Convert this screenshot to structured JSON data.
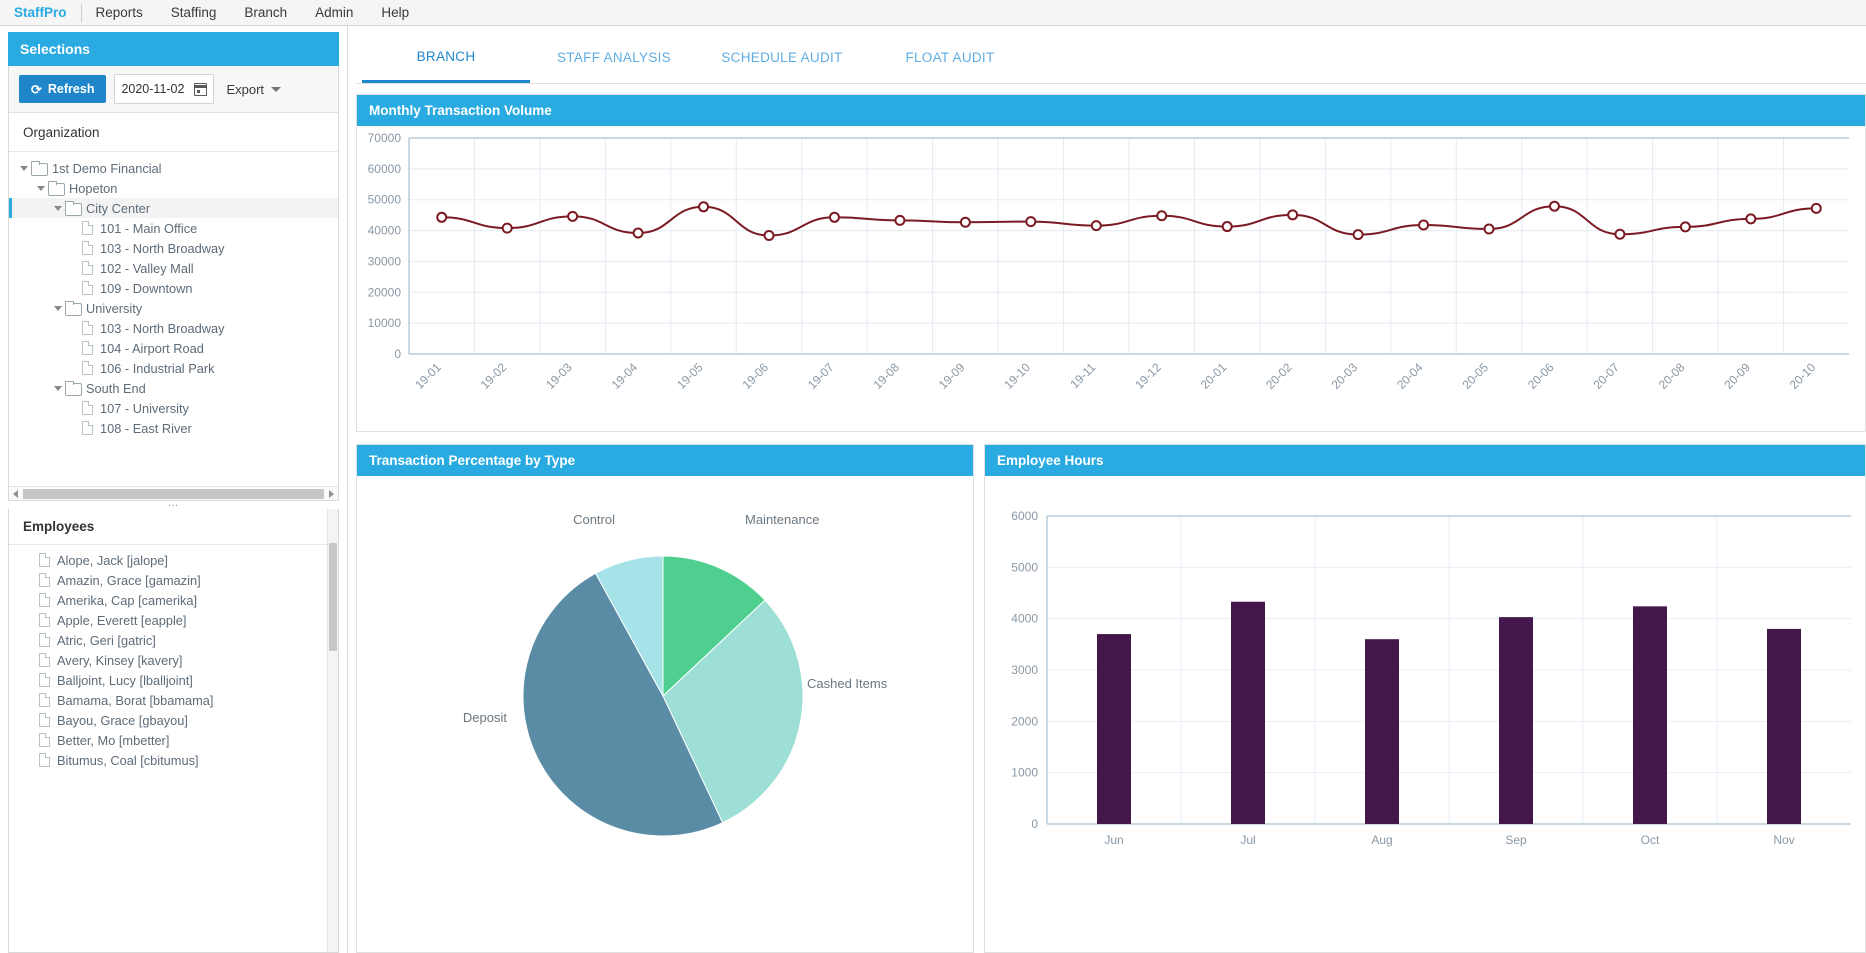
{
  "menu": {
    "brand": "StaffPro",
    "items": [
      "Reports",
      "Staffing",
      "Branch",
      "Admin",
      "Help"
    ]
  },
  "selections": {
    "title": "Selections",
    "refresh_label": "Refresh",
    "date_value": "2020-11-02",
    "export_label": "Export",
    "organization_label": "Organization",
    "tree": [
      {
        "label": "1st Demo Financial",
        "type": "folder",
        "depth": 0,
        "expanded": true,
        "selected": false
      },
      {
        "label": "Hopeton",
        "type": "folder",
        "depth": 1,
        "expanded": true,
        "selected": false
      },
      {
        "label": "City Center",
        "type": "folder",
        "depth": 2,
        "expanded": true,
        "selected": true
      },
      {
        "label": "101 - Main Office",
        "type": "file",
        "depth": 3,
        "expanded": false,
        "selected": false
      },
      {
        "label": "103 - North Broadway",
        "type": "file",
        "depth": 3,
        "expanded": false,
        "selected": false
      },
      {
        "label": "102 - Valley Mall",
        "type": "file",
        "depth": 3,
        "expanded": false,
        "selected": false
      },
      {
        "label": "109 - Downtown",
        "type": "file",
        "depth": 3,
        "expanded": false,
        "selected": false
      },
      {
        "label": "University",
        "type": "folder",
        "depth": 2,
        "expanded": true,
        "selected": false
      },
      {
        "label": "103 - North Broadway",
        "type": "file",
        "depth": 3,
        "expanded": false,
        "selected": false
      },
      {
        "label": "104 - Airport Road",
        "type": "file",
        "depth": 3,
        "expanded": false,
        "selected": false
      },
      {
        "label": "106 - Industrial Park",
        "type": "file",
        "depth": 3,
        "expanded": false,
        "selected": false
      },
      {
        "label": "South End",
        "type": "folder",
        "depth": 2,
        "expanded": true,
        "selected": false
      },
      {
        "label": "107 - University",
        "type": "file",
        "depth": 3,
        "expanded": false,
        "selected": false
      },
      {
        "label": "108 - East River",
        "type": "file",
        "depth": 3,
        "expanded": false,
        "selected": false
      }
    ]
  },
  "employees": {
    "title": "Employees",
    "items": [
      "Alope, Jack [jalope]",
      "Amazin, Grace [gamazin]",
      "Amerika, Cap [camerika]",
      "Apple, Everett [eapple]",
      "Atric, Geri [gatric]",
      "Avery, Kinsey [kavery]",
      "Balljoint, Lucy [lballjoint]",
      "Bamama, Borat [bbamama]",
      "Bayou, Grace [gbayou]",
      "Better, Mo [mbetter]",
      "Bitumus, Coal [cbitumus]"
    ]
  },
  "tabs": [
    {
      "label": "BRANCH",
      "active": true
    },
    {
      "label": "STAFF ANALYSIS",
      "active": false
    },
    {
      "label": "SCHEDULE AUDIT",
      "active": false
    },
    {
      "label": "FLOAT AUDIT",
      "active": false
    }
  ],
  "cards": {
    "line_title": "Monthly Transaction Volume",
    "pie_title": "Transaction Percentage by Type",
    "bar_title": "Employee Hours"
  },
  "colors": {
    "accent": "#29abe2",
    "primary_button": "#1f87c9",
    "line_series": "#7b1a23",
    "bar_series": "#45164b",
    "pie_maintenance": "#4ecf90",
    "pie_cashed": "#9ddfd6",
    "pie_deposit": "#5b8ca6",
    "pie_control": "#a5e3e8"
  },
  "chart_data": [
    {
      "type": "line",
      "title": "Monthly Transaction Volume",
      "xlabel": "",
      "ylabel": "",
      "ylim": [
        0,
        70000
      ],
      "yticks": [
        0,
        10000,
        20000,
        30000,
        40000,
        50000,
        60000,
        70000
      ],
      "grid": true,
      "legend": "none",
      "x": [
        "19-01",
        "19-02",
        "19-03",
        "19-04",
        "19-05",
        "19-06",
        "19-07",
        "19-08",
        "19-09",
        "19-10",
        "19-11",
        "19-12",
        "20-01",
        "20-02",
        "20-03",
        "20-04",
        "20-05",
        "20-06",
        "20-07",
        "20-08",
        "20-09",
        "20-10"
      ],
      "series": [
        {
          "name": "Transaction Volume",
          "values": [
            44300,
            40800,
            44600,
            39200,
            47700,
            38400,
            44300,
            43300,
            42700,
            42900,
            41600,
            44800,
            41300,
            45100,
            38700,
            41800,
            40500,
            47900,
            38800,
            41200,
            43800,
            47200
          ]
        }
      ]
    },
    {
      "type": "pie",
      "title": "Transaction Percentage by Type",
      "labels": [
        "Maintenance",
        "Cashed Items",
        "Deposit",
        "Control"
      ],
      "values": [
        13,
        30,
        49,
        8
      ],
      "colors": [
        "#4ecf90",
        "#9ddfd6",
        "#5b8ca6",
        "#a5e3e8"
      ]
    },
    {
      "type": "bar",
      "title": "Employee Hours",
      "categories": [
        "Jun",
        "Jul",
        "Aug",
        "Sep",
        "Oct",
        "Nov"
      ],
      "values": [
        3700,
        4330,
        3600,
        4030,
        4240,
        3800
      ],
      "xlabel": "",
      "ylabel": "",
      "ylim": [
        0,
        6000
      ],
      "yticks": [
        0,
        1000,
        2000,
        3000,
        4000,
        5000,
        6000
      ],
      "grid": true,
      "color": "#45164b"
    }
  ]
}
